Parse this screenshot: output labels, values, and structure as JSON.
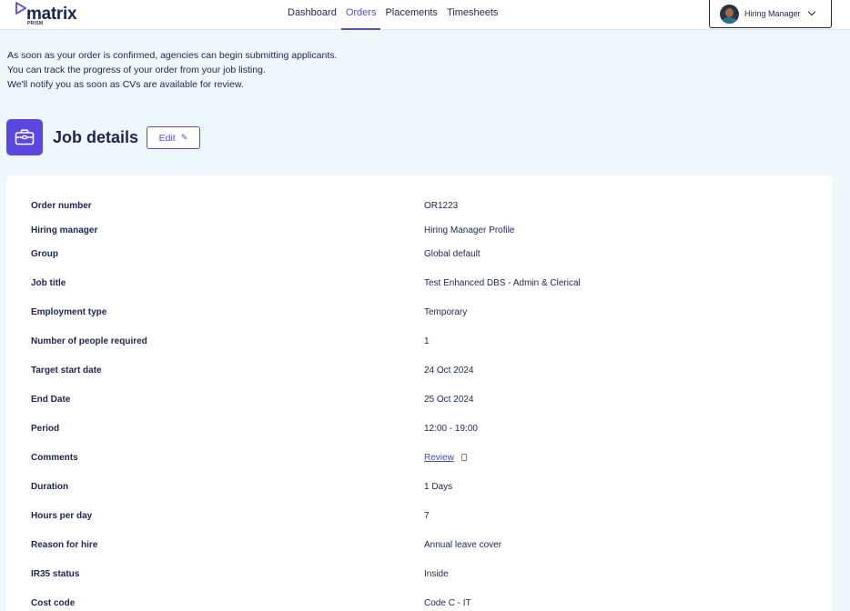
{
  "header": {
    "logo_text": "matrix",
    "logo_sub": "PRISM",
    "nav": [
      {
        "label": "Dashboard"
      },
      {
        "label": "Orders"
      },
      {
        "label": "Placements"
      },
      {
        "label": "Timesheets"
      }
    ],
    "active_nav": "Orders",
    "user_name": "Hiring Manager"
  },
  "info_lines": [
    "As soon as your order is confirmed, agencies can begin submitting applicants.",
    "You can track the progress of your order from your job listing.",
    "We'll notify you as soon as CVs are available for review."
  ],
  "title": "Job details",
  "edit_label": "Edit",
  "details": [
    {
      "label": "Order number",
      "value": "OR1223"
    },
    {
      "label": "Hiring manager",
      "value": "Hiring Manager Profile"
    },
    {
      "label": "Group",
      "value": "Global default"
    },
    {
      "label": "Job title",
      "value": "Test Enhanced DBS - Admin & Clerical"
    },
    {
      "label": "Employment type",
      "value": "Temporary"
    },
    {
      "label": "Number of people required",
      "value": "1"
    },
    {
      "label": "Target start date",
      "value": "24 Oct 2024"
    },
    {
      "label": "End Date",
      "value": "25 Oct 2024"
    },
    {
      "label": "Period",
      "value": "12:00 - 19:00"
    },
    {
      "label": "Comments",
      "value": "Review"
    },
    {
      "label": "Duration",
      "value": "1 Days"
    },
    {
      "label": "Hours per day",
      "value": "7"
    },
    {
      "label": "Reason for hire",
      "value": "Annual leave cover"
    },
    {
      "label": "IR35 status",
      "value": "Inside"
    },
    {
      "label": "Cost code",
      "value": "Code C - IT"
    }
  ],
  "colors": {
    "accent": "#5b46e0",
    "text": "#1c2552",
    "background": "#eef7fb"
  }
}
